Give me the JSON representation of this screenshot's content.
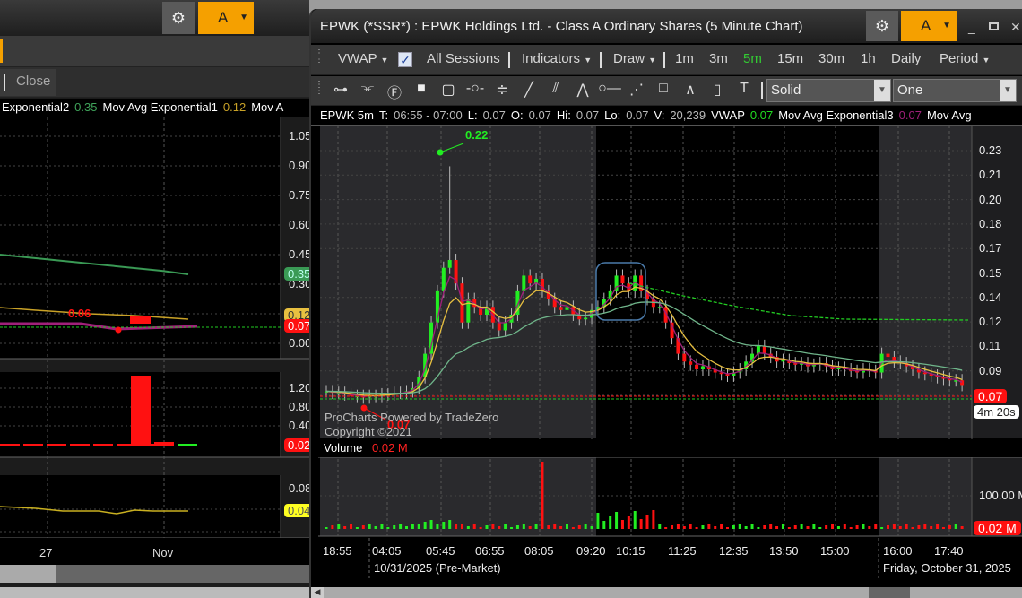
{
  "left_window": {
    "gear_icon": "gear-icon",
    "account_label": "A",
    "toolbar_close": "Close",
    "legend": [
      {
        "text": "Exponential2",
        "color": "#ffffff"
      },
      {
        "text": "0.35",
        "color": "#3fa35a"
      },
      {
        "text": "Mov Avg Exponential1",
        "color": "#ffffff"
      },
      {
        "text": "0.12",
        "color": "#c9a227"
      },
      {
        "text": "Mov A",
        "color": "#ffffff"
      }
    ],
    "price_ticks": [
      "1.05",
      "0.90",
      "0.75",
      "0.60",
      "0.45",
      "0.30",
      "0.15",
      "0.00"
    ],
    "ema2_tag": "0.35",
    "ema1_tag": "0.12",
    "last_tag": "0.07",
    "low_label": "0.06",
    "volume_ticks": [
      "1.20",
      "0.80",
      "0.40"
    ],
    "volume_tag": "0.02",
    "lower_ticks": [
      "0.08"
    ],
    "lower_tag": "0.04",
    "x_labels": [
      "27",
      "Nov"
    ]
  },
  "main_window": {
    "title": "EPWK (*SSR*) : EPWK Holdings Ltd. - Class A Ordinary Shares (5 Minute Chart)",
    "account_label": "A",
    "toolbar1": {
      "vwap": "VWAP",
      "all_sessions": "All Sessions",
      "all_sessions_checked": true,
      "indicators": "Indicators",
      "draw": "Draw",
      "intervals": [
        "1m",
        "3m",
        "5m",
        "15m",
        "30m",
        "1h",
        "Daily"
      ],
      "active_interval": "5m",
      "period": "Period"
    },
    "toolbar2": {
      "tools": [
        "dot-line-icon",
        "parallel-lines-icon",
        "fibonacci-icon",
        "filled-rect-icon",
        "rounded-rect-icon",
        "horizontal-line-icon",
        "channel-icon",
        "trendline-icon",
        "pitchfork-icon",
        "arrow-icon",
        "ray-icon",
        "regression-icon",
        "rectangle-icon",
        "angle-icon",
        "ellipse-icon",
        "text-icon"
      ],
      "line_style": "Solid",
      "line_width": "One"
    },
    "legend": [
      {
        "text": "EPWK 5m",
        "color": "#ffffff"
      },
      {
        "text": "T:",
        "color": "#ffffff"
      },
      {
        "text": "06:55 - 07:00",
        "color": "#bbbbbb"
      },
      {
        "text": "L:",
        "color": "#ffffff"
      },
      {
        "text": "0.07",
        "color": "#bbbbbb"
      },
      {
        "text": "O:",
        "color": "#ffffff"
      },
      {
        "text": "0.07",
        "color": "#bbbbbb"
      },
      {
        "text": "Hi:",
        "color": "#ffffff"
      },
      {
        "text": "0.07",
        "color": "#bbbbbb"
      },
      {
        "text": "Lo:",
        "color": "#ffffff"
      },
      {
        "text": "0.07",
        "color": "#bbbbbb"
      },
      {
        "text": "V:",
        "color": "#ffffff"
      },
      {
        "text": "20,239",
        "color": "#bbbbbb"
      },
      {
        "text": "VWAP",
        "color": "#ffffff"
      },
      {
        "text": "0.07",
        "color": "#22dd22"
      },
      {
        "text": "Mov Avg Exponential3",
        "color": "#ffffff"
      },
      {
        "text": "0.07",
        "color": "#a0207a"
      },
      {
        "text": "Mov Avg",
        "color": "#ffffff"
      }
    ],
    "watermark": [
      "ProCharts Powered by TradeZero",
      "Copyright ©2021"
    ],
    "high_label": "0.22",
    "low_label": "0.07",
    "last_price_tag": "0.07",
    "countdown": "4m 20s",
    "volume_label": "Volume",
    "volume_value": "0.02 M",
    "volume_tick": "100.00 M",
    "volume_tag": "0.02 M",
    "time_labels": [
      "18:55",
      "04:05",
      "05:45",
      "06:55",
      "08:05",
      "09:20",
      "10:15",
      "11:25",
      "12:35",
      "13:50",
      "15:00",
      "16:00",
      "17:40"
    ],
    "date_labels": [
      "10/31/2025 (Pre-Market)",
      "Friday, October 31, 2025"
    ]
  },
  "chart_data": {
    "type": "candlestick",
    "symbol": "EPWK",
    "interval": "5m",
    "y_ticks": [
      "0.23",
      "0.21",
      "0.20",
      "0.18",
      "0.17",
      "0.15",
      "0.14",
      "0.12",
      "0.11",
      "0.09",
      "0.07"
    ],
    "ylim": [
      0.06,
      0.24
    ],
    "closes": [
      0.076,
      0.075,
      0.075,
      0.074,
      0.073,
      0.073,
      0.072,
      0.073,
      0.073,
      0.074,
      0.074,
      0.075,
      0.075,
      0.076,
      0.078,
      0.085,
      0.1,
      0.12,
      0.14,
      0.155,
      0.16,
      0.145,
      0.12,
      0.135,
      0.13,
      0.125,
      0.13,
      0.12,
      0.115,
      0.12,
      0.125,
      0.14,
      0.15,
      0.145,
      0.148,
      0.14,
      0.135,
      0.13,
      0.128,
      0.13,
      0.125,
      0.122,
      0.123,
      0.128,
      0.13,
      0.135,
      0.14,
      0.15,
      0.145,
      0.14,
      0.15,
      0.14,
      0.135,
      0.13,
      0.13,
      0.12,
      0.11,
      0.1,
      0.095,
      0.093,
      0.09,
      0.092,
      0.09,
      0.088,
      0.087,
      0.086,
      0.088,
      0.09,
      0.095,
      0.1,
      0.105,
      0.1,
      0.098,
      0.095,
      0.096,
      0.094,
      0.093,
      0.094,
      0.092,
      0.093,
      0.094,
      0.092,
      0.09,
      0.091,
      0.09,
      0.089,
      0.088,
      0.09,
      0.089,
      0.088,
      0.1,
      0.098,
      0.095,
      0.094,
      0.092,
      0.09,
      0.088,
      0.087,
      0.086,
      0.085,
      0.084,
      0.083,
      0.083,
      0.08
    ],
    "spike_high": 0.22,
    "session_low": 0.07,
    "vwap_end": 0.12,
    "volume_spike_index": 35,
    "colors": {
      "up": "#22ee22",
      "down": "#ff1111",
      "ema_fast": "#a0207a",
      "ema_mid": "#e8c040",
      "ema_slow": "#6fb58a",
      "vwap": "#22cc22"
    }
  }
}
